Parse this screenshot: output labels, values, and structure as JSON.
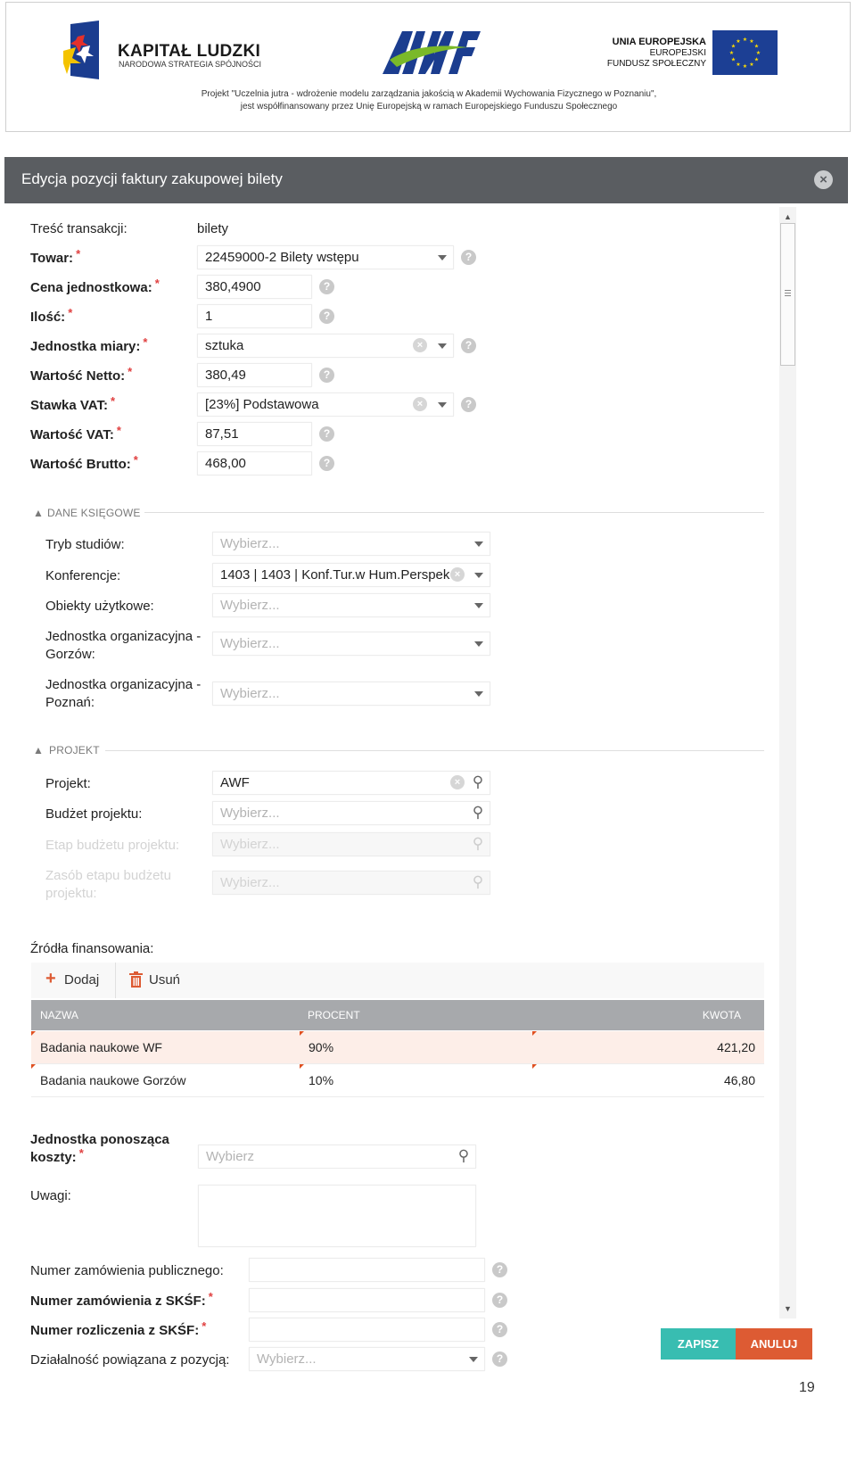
{
  "header": {
    "logo_left_title": "KAPITAŁ LUDZKI",
    "logo_left_subtitle": "NARODOWA STRATEGIA SPÓJNOŚCI",
    "eu_line1": "UNIA EUROPEJSKA",
    "eu_line2": "EUROPEJSKI",
    "eu_line3": "FUNDUSZ SPOŁECZNY",
    "project_note_line1": "Projekt \"Uczelnia jutra - wdrożenie modelu zarządzania jakością w Akademii Wychowania Fizycznego w Poznaniu\",",
    "project_note_line2": "jest współfinansowany przez Unię Europejską w ramach Europejskiego Funduszu Społecznego"
  },
  "dialog": {
    "title": "Edycja pozycji faktury zakupowej bilety",
    "close_icon": "close-icon"
  },
  "form": {
    "transaction_label": "Treść transakcji:",
    "transaction_value": "bilety",
    "towar_label": "Towar:",
    "towar_value": "22459000-2 Bilety wstępu",
    "cena_label": "Cena jednostkowa:",
    "cena_value": "380,4900",
    "ilosc_label": "Ilość:",
    "ilosc_value": "1",
    "jm_label": "Jednostka miary:",
    "jm_value": "sztuka",
    "netto_label": "Wartość Netto:",
    "netto_value": "380,49",
    "stawka_label": "Stawka VAT:",
    "stawka_value": "[23%] Podstawowa",
    "vat_label": "Wartość VAT:",
    "vat_value": "87,51",
    "brutto_label": "Wartość Brutto:",
    "brutto_value": "468,00",
    "required_mark": "*",
    "help_glyph": "?"
  },
  "accounting": {
    "section_title": "DANE KSIĘGOWE",
    "tryb_label": "Tryb studiów:",
    "tryb_value": "Wybierz...",
    "konf_label": "Konferencje:",
    "konf_value": "1403 | 1403 | Konf.Tur.w Hum.Perspek",
    "obiekty_label": "Obiekty użytkowe:",
    "obiekty_value": "Wybierz...",
    "jo_gorzow_label1": "Jednostka organizacyjna -",
    "jo_gorzow_label2": "Gorzów:",
    "jo_gorzow_value": "Wybierz...",
    "jo_poznan_label1": "Jednostka organizacyjna -",
    "jo_poznan_label2": "Poznań:",
    "jo_poznan_value": "Wybierz..."
  },
  "project": {
    "section_title": "PROJEKT",
    "projekt_label": "Projekt:",
    "projekt_value": "AWF",
    "budzet_label": "Budżet projektu:",
    "budzet_value": "Wybierz...",
    "etap_label": "Etap budżetu projektu:",
    "etap_value": "Wybierz...",
    "zasob_label1": "Zasób etapu budżetu",
    "zasob_label2": "projektu:",
    "zasob_value": "Wybierz..."
  },
  "funding": {
    "label": "Źródła finansowania:",
    "add_label": "Dodaj",
    "remove_label": "Usuń",
    "columns": [
      "NAZWA",
      "PROCENT",
      "KWOTA"
    ],
    "rows": [
      {
        "name": "Badania naukowe WF",
        "percent": "90%",
        "amount": "421,20"
      },
      {
        "name": "Badania naukowe Gorzów",
        "percent": "10%",
        "amount": "46,80"
      }
    ],
    "selected_row_color": "#fdeee8"
  },
  "bottom": {
    "jedn_label1": "Jednostka ponosząca",
    "jedn_label2": "koszty:",
    "jedn_value": "Wybierz",
    "uwagi_label": "Uwagi:",
    "nr_zam_pub_label": "Numer zamówienia publicznego:",
    "nr_zam_skef_label": "Numer zamówienia z SKŚF:",
    "nr_rozl_label": "Numer rozliczenia z SKŚF:",
    "dzial_label": "Działalność powiązana z pozycją:",
    "dzial_value": "Wybierz..."
  },
  "buttons": {
    "save": "ZAPISZ",
    "cancel": "ANULUJ"
  },
  "page_number": "19",
  "colors": {
    "titlebar": "#5a5d61",
    "save": "#38bdb1",
    "cancel": "#dd5b33",
    "grid_header": "#a7a9ac",
    "required": "#e04040"
  }
}
